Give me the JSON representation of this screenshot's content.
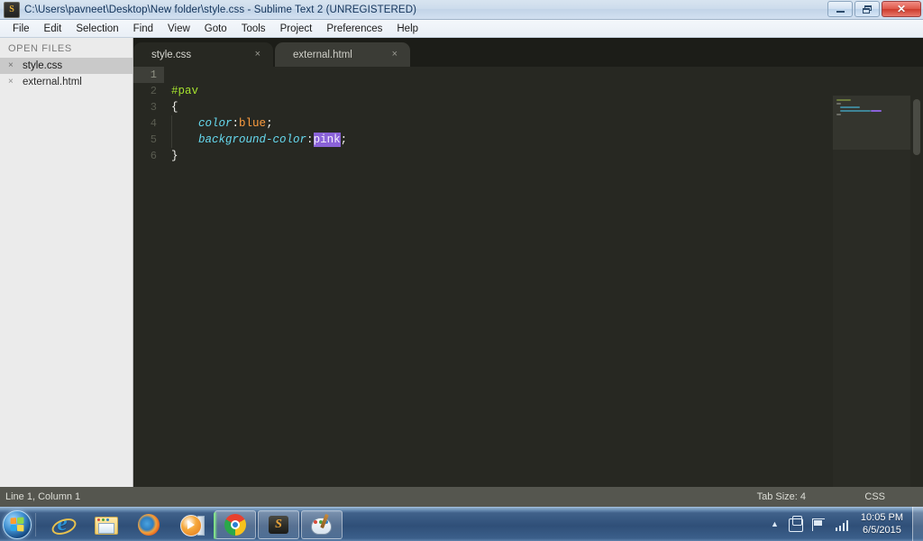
{
  "window": {
    "title": "C:\\Users\\pavneet\\Desktop\\New folder\\style.css - Sublime Text 2 (UNREGISTERED)",
    "app_icon": "sublime-text-icon",
    "icon_letter": "S",
    "controls": {
      "minimize": "minimize-button",
      "restore": "restore-button",
      "close": "close-button",
      "close_glyph": "✕"
    }
  },
  "menu": {
    "items": [
      {
        "label": "File"
      },
      {
        "label": "Edit"
      },
      {
        "label": "Selection"
      },
      {
        "label": "Find"
      },
      {
        "label": "View"
      },
      {
        "label": "Goto"
      },
      {
        "label": "Tools"
      },
      {
        "label": "Project"
      },
      {
        "label": "Preferences"
      },
      {
        "label": "Help"
      }
    ]
  },
  "sidebar": {
    "header": "OPEN FILES",
    "close_glyph": "×",
    "items": [
      {
        "label": "style.css",
        "selected": true
      },
      {
        "label": "external.html",
        "selected": false
      }
    ]
  },
  "tabs": [
    {
      "label": "style.css",
      "active": true,
      "close_glyph": "×"
    },
    {
      "label": "external.html",
      "active": false,
      "close_glyph": "×"
    }
  ],
  "editor": {
    "gutter": [
      "1",
      "2",
      "3",
      "4",
      "5",
      "6"
    ],
    "current_line": 1,
    "lines": [
      {
        "n": "1",
        "text": ""
      },
      {
        "n": "2",
        "text": "#pav"
      },
      {
        "n": "3",
        "text": "{"
      },
      {
        "n": "4",
        "text": "    color:blue;"
      },
      {
        "n": "5",
        "text": "    background-color:pink;"
      },
      {
        "n": "6",
        "text": "}"
      }
    ],
    "tokens": {
      "selector": "#pav",
      "open_brace": "{",
      "close_brace": "}",
      "prop1": "color",
      "colon": ":",
      "val1": "blue",
      "semi": ";",
      "prop2": "background-color",
      "val2_selected": "pink",
      "indent": "    "
    },
    "selection_value": "pink"
  },
  "statusbar": {
    "position": "Line 1, Column 1",
    "tab_size": "Tab Size: 4",
    "language": "CSS"
  },
  "taskbar": {
    "start": "windows-start-orb",
    "buttons": [
      {
        "name": "internet-explorer",
        "running": false
      },
      {
        "name": "windows-explorer",
        "running": false
      },
      {
        "name": "firefox",
        "running": false
      },
      {
        "name": "windows-media-player",
        "running": false
      },
      {
        "name": "google-chrome",
        "running": true
      },
      {
        "name": "sublime-text",
        "running": true
      },
      {
        "name": "paint",
        "running": true
      }
    ],
    "tray": {
      "show_hidden_glyph": "▲",
      "icons": [
        "action-center-icon",
        "network-flag-icon",
        "network-signal-icon"
      ],
      "time": "10:05 PM",
      "date": "6/5/2015"
    }
  },
  "colors": {
    "editor_bg": "#272822",
    "tabbar_bg": "#1c1d18",
    "sidebar_bg": "#ebebeb",
    "statusbar_bg": "#55564f",
    "selector_green": "#a6e22e",
    "property_cyan": "#66d9ef",
    "value_orange": "#fd9d3f",
    "selection_purple": "#8a62d8",
    "gutter_number": "#5a5c51"
  }
}
